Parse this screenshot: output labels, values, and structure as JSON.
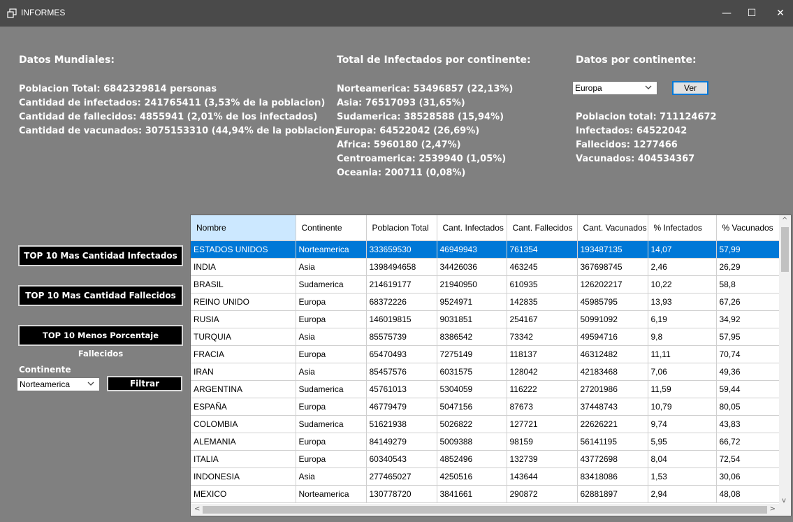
{
  "window": {
    "title": "INFORMES",
    "minimize": "—",
    "maximize": "☐",
    "close": "✕"
  },
  "mundial": {
    "heading": "Datos Mundiales:",
    "lines": [
      "Poblacion Total: 6842329814 personas",
      "Cantidad de infectados: 241765411 (3,53% de la poblacion)",
      "Cantidad de fallecidos: 4855941 (2,01% de los infectados)",
      "Cantidad de vacunados: 3075153310 (44,94% de la poblacion)"
    ]
  },
  "por_continente": {
    "heading": "Total de Infectados por continente:",
    "lines": [
      "Norteamerica:  53496857 (22,13%)",
      "Asia:  76517093 (31,65%)",
      "Sudamerica:  38528588 (15,94%)",
      "Europa:  64522042 (26,69%)",
      "Africa:  5960180 (2,47%)",
      "Centroamerica:  2539940 (1,05%)",
      "Oceania:  200711 (0,08%)"
    ]
  },
  "datos_continente": {
    "heading": "Datos por continente:",
    "select_value": "Europa",
    "ver_label": "Ver",
    "lines": [
      "Poblacion total: 711124672",
      "Infectados: 64522042",
      "Fallecidos: 1277466",
      "Vacunados: 404534367"
    ]
  },
  "buttons": {
    "top_infectados": "TOP 10 Mas Cantidad Infectados",
    "top_fallecidos": "TOP 10 Mas Cantidad Fallecidos",
    "top_menos_porcentaje": "TOP 10 Menos Porcentaje Fallecidos"
  },
  "filtro": {
    "label": "Continente",
    "select_value": "Norteamerica",
    "button_label": "Filtrar"
  },
  "table": {
    "columns": [
      "Nombre",
      "Continente",
      "Poblacion Total",
      "Cant. Infectados",
      "Cant. Fallecidos",
      "Cant. Vacunados",
      "% Infectados",
      "% Vacunados"
    ],
    "rows": [
      [
        "ESTADOS UNIDOS",
        "Norteamerica",
        "333659530",
        "46949943",
        "761354",
        "193487135",
        "14,07",
        "57,99"
      ],
      [
        "INDIA",
        "Asia",
        "1398494658",
        "34426036",
        "463245",
        "367698745",
        "2,46",
        "26,29"
      ],
      [
        "BRASIL",
        "Sudamerica",
        "214619177",
        "21940950",
        "610935",
        "126202217",
        "10,22",
        "58,8"
      ],
      [
        "REINO UNIDO",
        "Europa",
        "68372226",
        "9524971",
        "142835",
        "45985795",
        "13,93",
        "67,26"
      ],
      [
        "RUSIA",
        "Europa",
        "146019815",
        "9031851",
        "254167",
        "50991092",
        "6,19",
        "34,92"
      ],
      [
        "TURQUIA",
        "Asia",
        "85575739",
        "8386542",
        "73342",
        "49594716",
        "9,8",
        "57,95"
      ],
      [
        "FRACIA",
        "Europa",
        "65470493",
        "7275149",
        "118137",
        "46312482",
        "11,11",
        "70,74"
      ],
      [
        "IRAN",
        "Asia",
        "85457576",
        "6031575",
        "128042",
        "42183468",
        "7,06",
        "49,36"
      ],
      [
        "ARGENTINA",
        "Sudamerica",
        "45761013",
        "5304059",
        "116222",
        "27201986",
        "11,59",
        "59,44"
      ],
      [
        "ESPAÑA",
        "Europa",
        "46779479",
        "5047156",
        "87673",
        "37448743",
        "10,79",
        "80,05"
      ],
      [
        "COLOMBIA",
        "Sudamerica",
        "51621938",
        "5026822",
        "127721",
        "22626221",
        "9,74",
        "43,83"
      ],
      [
        "ALEMANIA",
        "Europa",
        "84149279",
        "5009388",
        "98159",
        "56141195",
        "5,95",
        "66,72"
      ],
      [
        "ITALIA",
        "Europa",
        "60340543",
        "4852496",
        "132739",
        "43772698",
        "8,04",
        "72,54"
      ],
      [
        "INDONESIA",
        "Asia",
        "277465027",
        "4250516",
        "143644",
        "83418086",
        "1,53",
        "30,06"
      ],
      [
        "MEXICO",
        "Norteamerica",
        "130778720",
        "3841661",
        "290872",
        "62881897",
        "2,94",
        "48,08"
      ]
    ]
  }
}
